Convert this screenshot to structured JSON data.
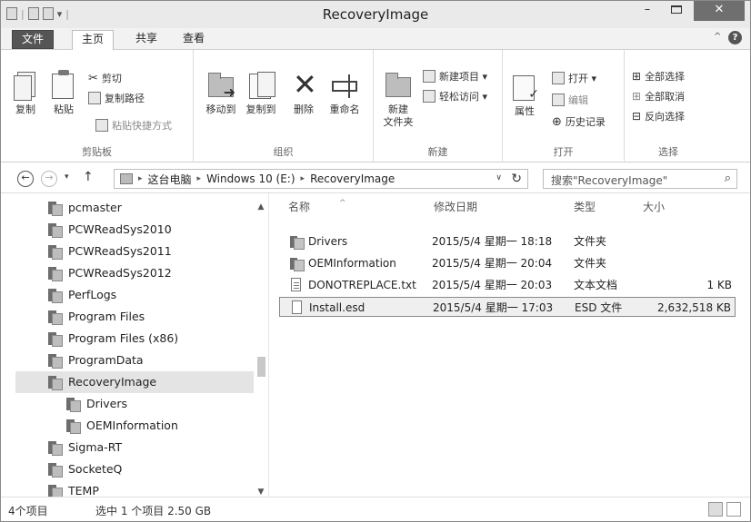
{
  "window": {
    "title": "RecoveryImage"
  },
  "qat": {
    "separator": "|",
    "dropdown": "▾"
  },
  "controls": {
    "minimize": "–",
    "close": "✕"
  },
  "tabs": {
    "file": "文件",
    "home": "主页",
    "share": "共享",
    "view": "查看",
    "collapse": "^",
    "help": "?"
  },
  "ribbon": {
    "clipboard": {
      "label": "剪贴板",
      "copy": "复制",
      "paste": "粘贴",
      "cut": "剪切",
      "copy_path": "复制路径",
      "paste_shortcut": "粘贴快捷方式"
    },
    "organize": {
      "label": "组织",
      "move_to": "移动到",
      "copy_to": "复制到",
      "delete": "删除",
      "rename": "重命名"
    },
    "new": {
      "label": "新建",
      "new_folder_line1": "新建",
      "new_folder_line2": "文件夹",
      "new_item": "新建项目 ▾",
      "easy_access": "轻松访问 ▾"
    },
    "open": {
      "label": "打开",
      "properties": "属性",
      "open": "打开 ▾",
      "edit": "编辑",
      "history": "历史记录"
    },
    "select": {
      "label": "选择",
      "select_all": "全部选择",
      "select_none": "全部取消",
      "invert": "反向选择"
    }
  },
  "addressbar": {
    "back": "←",
    "forward": "→",
    "recent": "▾",
    "up": "↑",
    "crumbs": [
      "这台电脑",
      "Windows 10 (E:)",
      "RecoveryImage"
    ],
    "chevron": "▸",
    "dropdown": "∨",
    "refresh": "↻",
    "search_placeholder": "搜索\"RecoveryImage\"",
    "search_icon": "⌕"
  },
  "nav": {
    "items": [
      {
        "label": "pcmaster",
        "sub": false
      },
      {
        "label": "PCWReadSys2010",
        "sub": false
      },
      {
        "label": "PCWReadSys2011",
        "sub": false
      },
      {
        "label": "PCWReadSys2012",
        "sub": false
      },
      {
        "label": "PerfLogs",
        "sub": false
      },
      {
        "label": "Program Files",
        "sub": false
      },
      {
        "label": "Program Files (x86)",
        "sub": false
      },
      {
        "label": "ProgramData",
        "sub": false
      },
      {
        "label": "RecoveryImage",
        "sub": false,
        "selected": true
      },
      {
        "label": "Drivers",
        "sub": true
      },
      {
        "label": "OEMInformation",
        "sub": true
      },
      {
        "label": "Sigma-RT",
        "sub": false
      },
      {
        "label": "SocketeQ",
        "sub": false
      },
      {
        "label": "TEMP",
        "sub": false
      }
    ],
    "scroll_up": "▲",
    "scroll_down": "▼"
  },
  "files": {
    "columns": {
      "name": "名称",
      "date": "修改日期",
      "type": "类型",
      "size": "大小"
    },
    "sort_indicator": "^",
    "rows": [
      {
        "name": "Drivers",
        "date": "2015/5/4 星期一 18:18",
        "type": "文件夹",
        "size": "",
        "kind": "folder"
      },
      {
        "name": "OEMInformation",
        "date": "2015/5/4 星期一 20:04",
        "type": "文件夹",
        "size": "",
        "kind": "folder"
      },
      {
        "name": "DONOTREPLACE.txt",
        "date": "2015/5/4 星期一 20:03",
        "type": "文本文档",
        "size": "1 KB",
        "kind": "txt"
      },
      {
        "name": "Install.esd",
        "date": "2015/5/4 星期一 17:03",
        "type": "ESD 文件",
        "size": "2,632,518 KB",
        "kind": "file",
        "selected": true
      }
    ]
  },
  "status": {
    "count": "4个项目",
    "selection": "选中 1 个项目  2.50 GB"
  }
}
